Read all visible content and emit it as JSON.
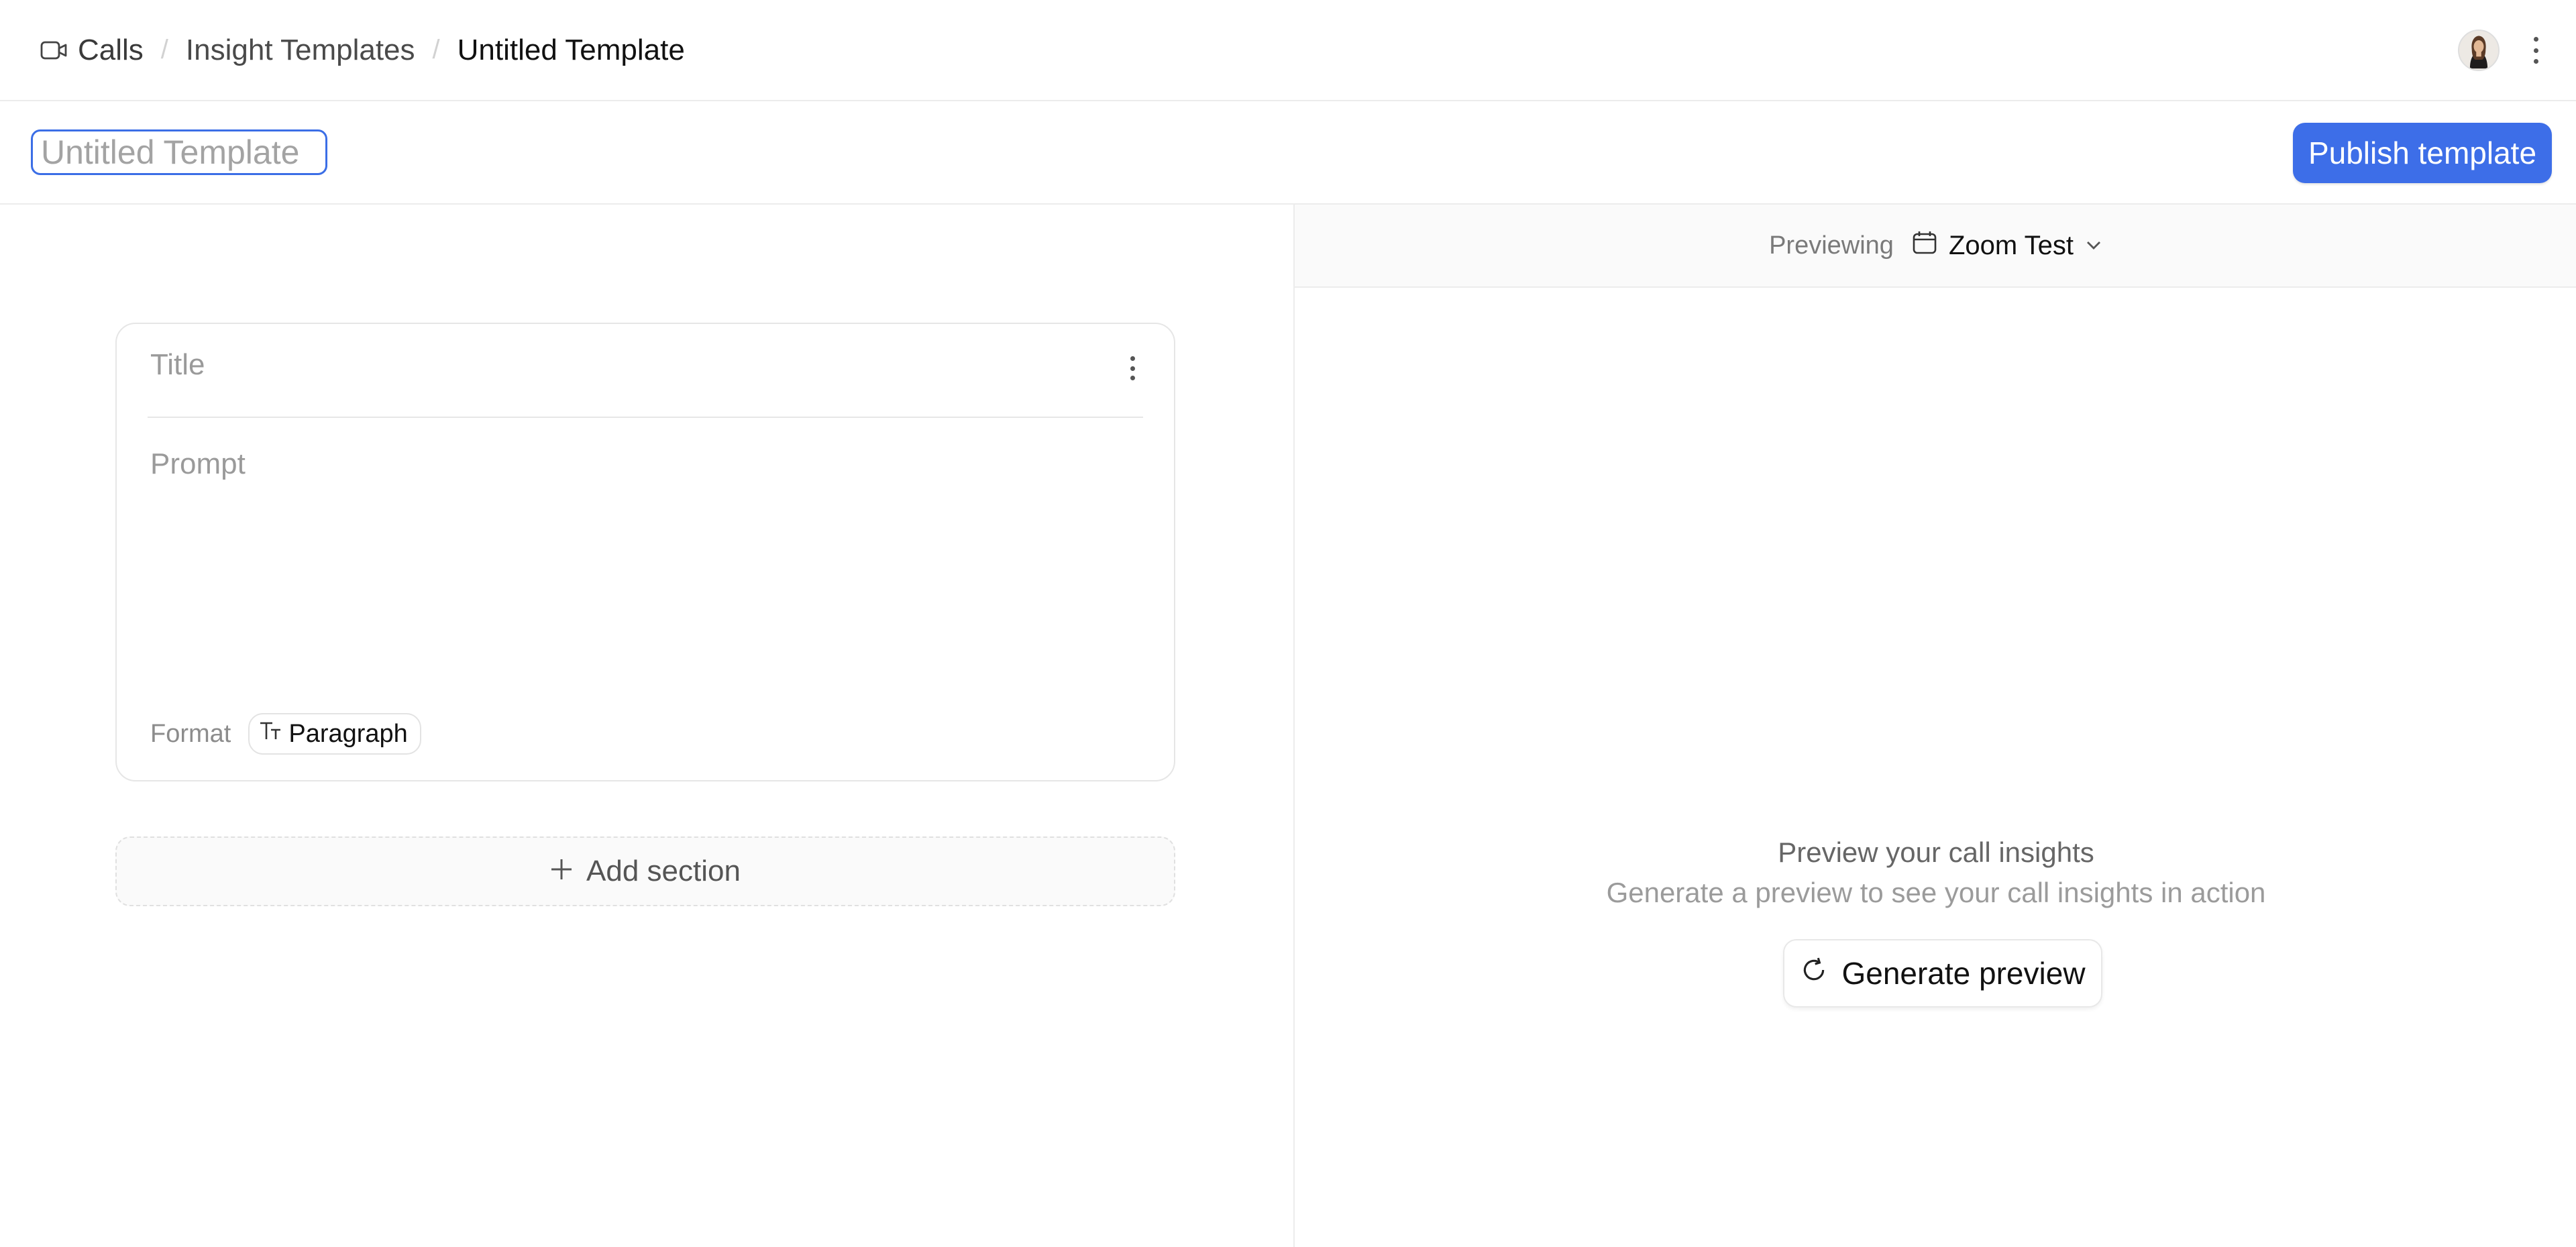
{
  "breadcrumb": {
    "icon": "video-camera-icon",
    "items": [
      "Calls",
      "Insight Templates",
      "Untitled Template"
    ]
  },
  "header": {
    "avatar": "user-avatar",
    "more_icon": "more-vertical-icon"
  },
  "template": {
    "name_placeholder": "Untitled Template",
    "name_value": "",
    "publish_label": "Publish template",
    "accent": "#3d6ee8"
  },
  "section": {
    "title_placeholder": "Title",
    "prompt_placeholder": "Prompt",
    "format_label": "Format",
    "format_icon_text": "TT",
    "format_value": "Paragraph"
  },
  "add_section_label": "Add section",
  "preview": {
    "label": "Previewing",
    "selected_call": "Zoom Test",
    "calendar_icon": "calendar-icon",
    "chevron_icon": "chevron-down-icon",
    "empty_title": "Preview your call insights",
    "empty_subtitle": "Generate a preview to see your call insights in action",
    "generate_label": "Generate preview",
    "refresh_icon": "refresh-icon"
  }
}
